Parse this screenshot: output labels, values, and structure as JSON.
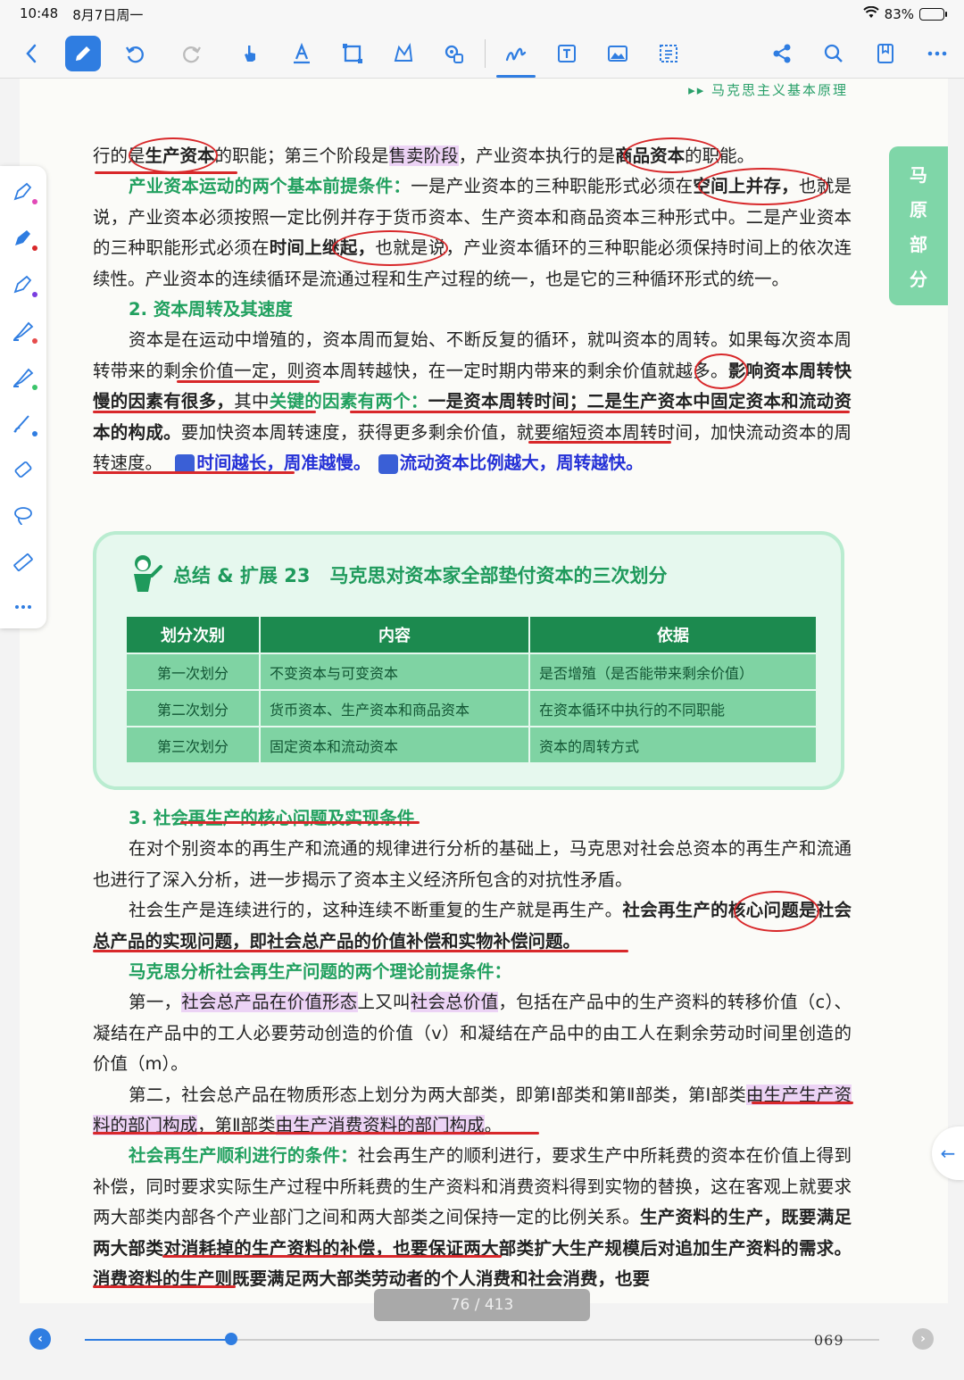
{
  "status": {
    "time": "10:48",
    "date": "8月7日周一",
    "battery": "83%",
    "battery_level": 0.83
  },
  "toolbar": {
    "active_tool": "pen"
  },
  "page": {
    "running_head": "▸▸ 马克思主义基本原理",
    "thumb_tab": [
      "马",
      "原",
      "部",
      "分"
    ],
    "folio": "069"
  },
  "body": {
    "p1": {
      "t1": "行的是",
      "t2": "生产资本",
      "t3": "的职能；第三个阶段是",
      "t4": "售卖阶段",
      "t5": "，产业资本执行的是",
      "t6": "商品资本",
      "t7": "的职能。"
    },
    "p2": {
      "head": "产业资本运动的两个基本前提条件：",
      "t1": "一是产业资本的三种职能形式必须在",
      "t2": "空间上并存，",
      "t3": "也就是说，产业资本必须按照一定比例并存于货币资本、生产资本和商品资本三种形式中。二是产业资本的三种职能形式必须在",
      "t4": "时间上继起，",
      "t5": "也就是说，产业资本循环的三种职能必须保持时间上的依次连续性。产业资本的连续循环是流通过程和生产过程的统一，也是它的三种循环形式的统一。"
    },
    "sec2": "2. 资本周转及其速度",
    "p3": {
      "t1": "资本是在运动中增殖的，资本周而复始、不断反复的循环，就叫资本的周转。如果每次资本周转带来的剩余价值一定，则资本周转越快，在一定时期内带来的剩余价值就越多。",
      "t2": "影响资本周转快慢的因素有很多，",
      "t3": "其中",
      "t4": "关键的因素有两个：",
      "t5": "一是资本周转时间；二是生产资本中固定资本和流动资本的构成。",
      "t6": "要加快资本周转速度，获得更多剩余价值，就要缩短资本周转时间，加快流动资本的周转速度。",
      "n1": "1",
      "a1": "时间越长，周准越慢。",
      "n2": "2",
      "a2": "流动资本比例越大，周转越快。"
    },
    "sec3": "3. 社会再生产的核心问题及实现条件",
    "p4": "在对个别资本的再生产和流通的规律进行分析的基础上，马克思对社会总资本的再生产和流通也进行了深入分析，进一步揭示了资本主义经济所包含的对抗性矛盾。",
    "p5": {
      "t1": "社会生产是连续进行的，这种连续不断重复的生产就是再生产。",
      "t2": "社会再生产的核心问题是社会总产品的实现问题，即社会总产品的价值补偿和实物补偿问题。"
    },
    "p6_head": "马克思分析社会再生产问题的两个理论前提条件：",
    "p7": {
      "t1": "第一，",
      "t2": "社会总产品在价值形态",
      "t3": "上又叫",
      "t4": "社会总价值",
      "t5": "，包括在产品中的生产资料的转移价值（c）、凝结在产品中的工人必要劳动创造的价值（v）和凝结在产品中的由工人在剩余劳动时间里创造的价值（m）。"
    },
    "p8": {
      "t1": "第二，社会总产品在物质形态上划分为两大部类，即第Ⅰ部类和第Ⅱ部类，第Ⅰ部类",
      "t2": "由生产生产资料的部门构成",
      "t3": "，第Ⅱ部类",
      "t4": "由生产消费资料的部门构成",
      "t5": "。"
    },
    "p9": {
      "head": "社会再生产顺利进行的条件：",
      "t1": "社会再生产的顺利进行，要求生产中所耗费的资本在价值上得到补偿，同时要求实际生产过程中所耗费的生产资料和消费资料得到实物的替换，这在客观上就要求两大部类内部各个产业部门之间和两大部类之间保持一定的比例关系。",
      "t2": "生产资料的生产，既要满足两大部类对消耗掉的生产资料的补偿，也要保证两大部类扩大生产规模后对追加生产资料的需求。消费资料的生产则既要满足两大部类劳动者的个人消费和社会消费，也要"
    }
  },
  "summary": {
    "label": "总结 & 扩展 23",
    "title": "马克思对资本家全部垫付资本的三次划分",
    "headers": [
      "划分次别",
      "内容",
      "依据"
    ],
    "rows": [
      [
        "第一次划分",
        "不变资本与可变资本",
        "是否增殖（是否能带来剩余价值）"
      ],
      [
        "第二次划分",
        "货币资本、生产资本和商品资本",
        "在资本循环中执行的不同职能"
      ],
      [
        "第三次划分",
        "固定资本和流动资本",
        "资本的周转方式"
      ]
    ]
  },
  "pager": {
    "indicator": "76 / 413",
    "progress": 0.184
  },
  "colors": {
    "accent": "#2f7de1",
    "green": "#21a05f",
    "ink_red": "#d8282a",
    "highlight": "#ecd3f5"
  }
}
